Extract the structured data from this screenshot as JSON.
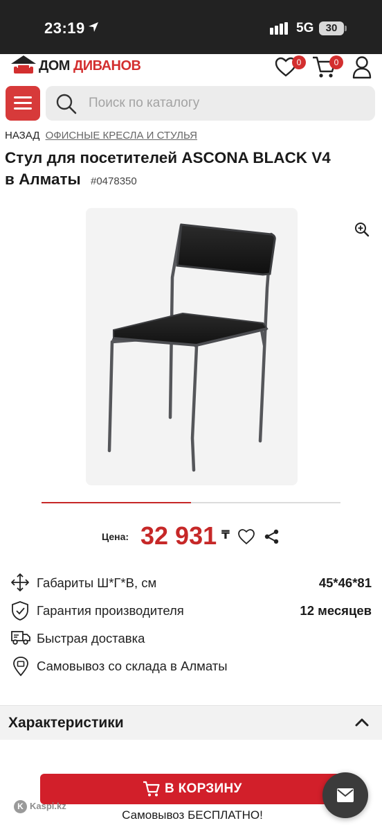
{
  "status_bar": {
    "time": "23:19",
    "network": "5G",
    "battery": "30"
  },
  "header": {
    "logo": {
      "part1": "ДОМ",
      "part2": "ДИВАНОВ"
    },
    "favorites_count": "0",
    "cart_count": "0"
  },
  "search": {
    "placeholder": "Поиск по каталогу",
    "value": ""
  },
  "breadcrumb": {
    "back": "НАЗАД",
    "category": "ОФИСНЫЕ КРЕСЛА И СТУЛЬЯ"
  },
  "product": {
    "title_line1": "Стул для посетителей ASCONA BLACK V4",
    "title_line2": "в Алматы",
    "sku": "#0478350",
    "gallery_progress": 0.5
  },
  "price": {
    "label": "Цена:",
    "value": "32 931",
    "currency": "₸"
  },
  "features": [
    {
      "icon": "move-arrows-icon",
      "label": "Габариты Ш*Г*В, см",
      "value": "45*46*81"
    },
    {
      "icon": "shield-check-icon",
      "label": "Гарантия производителя",
      "value": "12 месяцев"
    },
    {
      "icon": "delivery-truck-icon",
      "label": "Быстрая доставка",
      "value": ""
    },
    {
      "icon": "location-pin-icon",
      "label": "Самовывоз со склада в Алматы",
      "value": ""
    }
  ],
  "characteristics": {
    "title": "Характеристики"
  },
  "bottom": {
    "cart_button": "В КОРЗИНУ",
    "pickup_note": "Самовывоз БЕСПЛАТНО!",
    "kaspi": "Kaspi.kz"
  },
  "colors": {
    "accent": "#d21f2a",
    "price": "#c62828",
    "status_bar": "#222222"
  }
}
